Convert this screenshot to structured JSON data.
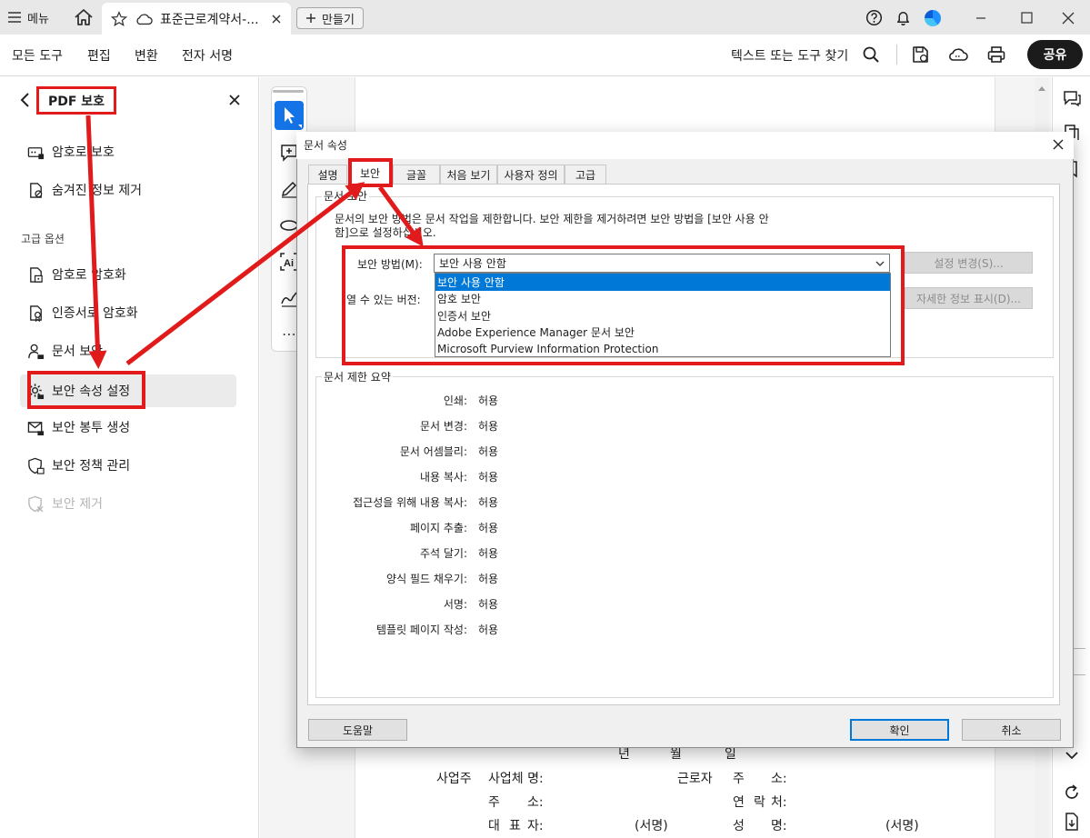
{
  "titlebar": {
    "menu_label": "메뉴",
    "tab_title": "표준근로계약서-...",
    "new_tab_label": "만들기"
  },
  "toolbar": {
    "items": [
      "모든 도구",
      "편집",
      "변환",
      "전자 서명"
    ],
    "search_label": "텍스트 또는 도구 찾기",
    "share_label": "공유"
  },
  "left_panel": {
    "title": "PDF 보호",
    "items_top": [
      {
        "label": "암호로 보호",
        "icon": "password-field-icon"
      },
      {
        "label": "숨겨진 정보 제거",
        "icon": "document-erase-icon"
      }
    ],
    "advanced_header": "고급 옵션",
    "items_advanced": [
      {
        "label": "암호로 암호화",
        "icon": "encrypt-password-icon"
      },
      {
        "label": "인증서로 암호화",
        "icon": "certificate-icon"
      },
      {
        "label": "문서 보안",
        "icon": "user-lock-icon"
      },
      {
        "label": "보안 속성 설정",
        "icon": "gear-lock-icon"
      },
      {
        "label": "보안 봉투 생성",
        "icon": "envelope-lock-icon"
      },
      {
        "label": "보안 정책 관리",
        "icon": "shield-doc-icon"
      },
      {
        "label": "보안 제거",
        "icon": "shield-remove-icon",
        "disabled": true
      }
    ]
  },
  "document": {
    "date_row": [
      "년",
      "월",
      "일"
    ],
    "employer_label": "사업주",
    "row1": [
      "사업체 명:",
      "근로자",
      "주",
      "소:"
    ],
    "row2": [
      "주",
      "소:",
      "연",
      "락",
      "처:"
    ],
    "row3": [
      "대",
      "표",
      "자:",
      "(서명)",
      "성",
      "명:",
      "(서명)"
    ]
  },
  "dialog": {
    "title": "문서 속성",
    "tabs": [
      "설명",
      "보안",
      "글꼴",
      "처음 보기",
      "사용자 정의",
      "고급"
    ],
    "active_tab": "보안",
    "security_group_label": "문서 보안",
    "security_desc_line1": "문서의 보안 방법은 문서 작업을 제한합니다. 보안 제한을 제거하려면 보안 방법을 [보안 사용 안",
    "security_desc_line2": "함]으로 설정하십시오.",
    "method_label": "보안 방법(M):",
    "method_value": "보안 사용 안함",
    "method_options": [
      "보안 사용 안함",
      "암호 보안",
      "인증서 보안",
      "Adobe Experience Manager 문서 보안",
      "Microsoft Purview Information Protection"
    ],
    "versions_label": "열 수 있는 버전:",
    "settings_change_label": "설정 변경(S)...",
    "details_label": "자세한 정보 표시(D)...",
    "summary_group_label": "문서 제한 요약",
    "permissions": [
      {
        "name": "인쇄:",
        "value": "허용"
      },
      {
        "name": "문서 변경:",
        "value": "허용"
      },
      {
        "name": "문서 어셈블리:",
        "value": "허용"
      },
      {
        "name": "내용 복사:",
        "value": "허용"
      },
      {
        "name": "접근성을 위해 내용 복사:",
        "value": "허용"
      },
      {
        "name": "페이지 추출:",
        "value": "허용"
      },
      {
        "name": "주석 달기:",
        "value": "허용"
      },
      {
        "name": "양식 필드 채우기:",
        "value": "허용"
      },
      {
        "name": "서명:",
        "value": "허용"
      },
      {
        "name": "템플릿 페이지 작성:",
        "value": "허용"
      }
    ],
    "help_label": "도움말",
    "ok_label": "확인",
    "cancel_label": "취소"
  },
  "colors": {
    "annotation_red": "#e11b1b",
    "accent_blue": "#1473e6",
    "selection_blue": "#0078d7"
  }
}
